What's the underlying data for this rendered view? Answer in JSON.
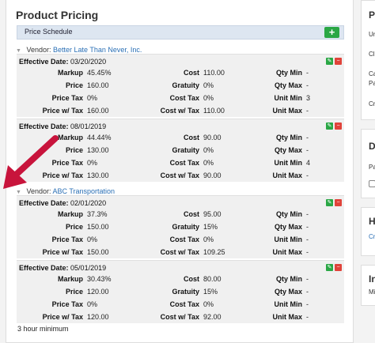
{
  "panel": {
    "title": "Product Pricing",
    "schedule_label": "Price Schedule",
    "add_label": "+",
    "footnote": "3 hour minimum"
  },
  "vendor_prefix": "Vendor:",
  "vendors": [
    {
      "name": "Better Late Than Never, Inc.",
      "entries": [
        {
          "effective_label": "Effective Date:",
          "effective_date": "03/20/2020",
          "markup": "45.45%",
          "price": "160.00",
          "price_tax": "0%",
          "price_w_tax": "160.00",
          "cost": "110.00",
          "gratuity": "0%",
          "cost_tax": "0%",
          "cost_w_tax": "110.00",
          "qty_min": "-",
          "qty_max": "-",
          "unit_min": "3",
          "unit_max": "-"
        },
        {
          "effective_label": "Effective Date:",
          "effective_date": "08/01/2019",
          "markup": "44.44%",
          "price": "130.00",
          "price_tax": "0%",
          "price_w_tax": "130.00",
          "cost": "90.00",
          "gratuity": "0%",
          "cost_tax": "0%",
          "cost_w_tax": "90.00",
          "qty_min": "-",
          "qty_max": "-",
          "unit_min": "4",
          "unit_max": "-"
        }
      ]
    },
    {
      "name": "ABC Transportation",
      "entries": [
        {
          "effective_label": "Effective Date:",
          "effective_date": "02/01/2020",
          "markup": "37.3%",
          "price": "150.00",
          "price_tax": "0%",
          "price_w_tax": "150.00",
          "cost": "95.00",
          "gratuity": "15%",
          "cost_tax": "0%",
          "cost_w_tax": "109.25",
          "qty_min": "-",
          "qty_max": "-",
          "unit_min": "-",
          "unit_max": "-"
        },
        {
          "effective_label": "Effective Date:",
          "effective_date": "05/01/2019",
          "markup": "30.43%",
          "price": "120.00",
          "price_tax": "0%",
          "price_w_tax": "120.00",
          "cost": "80.00",
          "gratuity": "15%",
          "cost_tax": "0%",
          "cost_w_tax": "92.00",
          "qty_min": "-",
          "qty_max": "-",
          "unit_min": "-",
          "unit_max": "-"
        }
      ]
    }
  ],
  "labels": {
    "markup": "Markup",
    "price": "Price",
    "price_tax": "Price Tax",
    "price_w_tax": "Price w/ Tax",
    "cost": "Cost",
    "gratuity": "Gratuity",
    "cost_tax": "Cost Tax",
    "cost_w_tax": "Cost w/ Tax",
    "qty_min": "Qty Min",
    "qty_max": "Qty Max",
    "unit_min": "Unit Min",
    "unit_max": "Unit Max"
  },
  "side": {
    "p1_title": "P",
    "p1_lines": [
      "Ur",
      "Cl",
      "Ca",
      "Pa",
      "Cr"
    ],
    "p2_title": "D",
    "p2_line": "Pa",
    "p3_title": "H",
    "p3_link": "Cr",
    "p4_title": "In",
    "p4_line": "Mi"
  },
  "colors": {
    "accent_link": "#2a6fb5",
    "add_green": "#2aa745",
    "delete_red": "#e0433a",
    "annotation_arrow": "#c8143c"
  }
}
